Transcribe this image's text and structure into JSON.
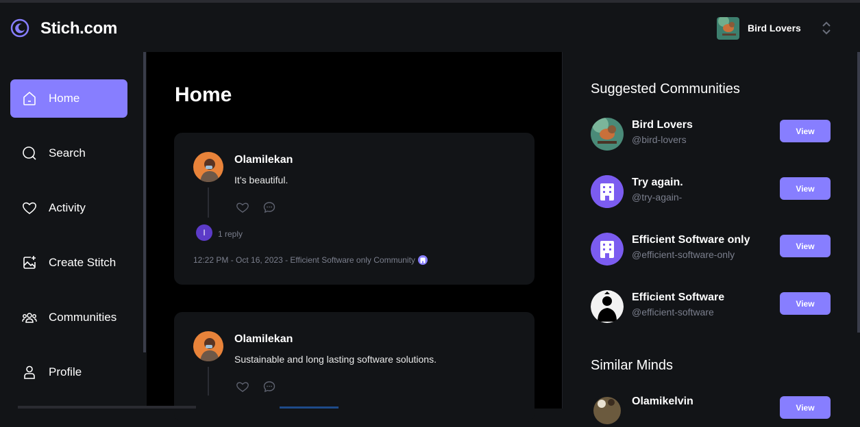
{
  "header": {
    "brand": "Stich.com",
    "org_name": "Bird Lovers"
  },
  "sidebar": {
    "items": [
      {
        "label": "Home",
        "icon": "home-icon",
        "active": true
      },
      {
        "label": "Search",
        "icon": "search-icon",
        "active": false
      },
      {
        "label": "Activity",
        "icon": "heart-icon",
        "active": false
      },
      {
        "label": "Create Stitch",
        "icon": "image-plus-icon",
        "active": false
      },
      {
        "label": "Communities",
        "icon": "people-icon",
        "active": false
      },
      {
        "label": "Profile",
        "icon": "user-icon",
        "active": false
      }
    ]
  },
  "main": {
    "title": "Home",
    "posts": [
      {
        "author": "Olamilekan",
        "text": "It’s beautiful.",
        "reply_initial": "I",
        "replies": "1 reply",
        "meta": "12:22 PM - Oct 16, 2023 - Efficient Software only Community"
      },
      {
        "author": "Olamilekan",
        "text": "Sustainable and long lasting software solutions."
      }
    ]
  },
  "right": {
    "suggested_title": "Suggested Communities",
    "communities": [
      {
        "name": "Bird Lovers",
        "handle": "@bird-lovers",
        "button": "View"
      },
      {
        "name": "Try again.",
        "handle": "@try-again-",
        "button": "View"
      },
      {
        "name": "Efficient Software only",
        "handle": "@efficient-software-only",
        "button": "View"
      },
      {
        "name": "Efficient Software",
        "handle": "@efficient-software",
        "button": "View"
      }
    ],
    "similar_title": "Similar Minds",
    "similar": [
      {
        "name": "Olamikelvin",
        "button": "View"
      }
    ]
  },
  "colors": {
    "accent": "#877eff",
    "background": "#121417",
    "main_background": "#000000",
    "muted_text": "#7b7f8d"
  }
}
